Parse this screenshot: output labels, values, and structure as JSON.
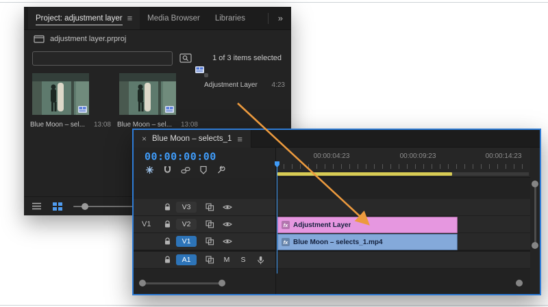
{
  "project": {
    "tabs": [
      {
        "label": "Project: adjustment layer"
      },
      {
        "label": "Media Browser"
      },
      {
        "label": "Libraries"
      }
    ],
    "panel_menu_glyph": "≡",
    "overflow_chevron": "»",
    "breadcrumb": "adjustment layer.prproj",
    "status": "1 of 3 items selected",
    "items": [
      {
        "name": "Blue Moon – sel...",
        "duration": "13:08"
      },
      {
        "name": "Blue Moon – sel...",
        "duration": "13:08"
      },
      {
        "name": "Adjustment Layer",
        "duration": "4:23"
      }
    ]
  },
  "timeline": {
    "close_glyph": "×",
    "tab_label": "Blue Moon – selects_1",
    "panel_menu_glyph": "≡",
    "timecode": "00:00:00:00",
    "ruler_labels": [
      "00:00:04:23",
      "00:00:09:23",
      "00:00:14:23"
    ],
    "tracks": {
      "v3": {
        "label": "V3"
      },
      "v2": {
        "label": "V2",
        "patch": "V1"
      },
      "v1": {
        "label": "V1"
      },
      "a1": {
        "label": "A1",
        "mute": "M",
        "solo": "S"
      }
    },
    "clips": {
      "adjustment": {
        "badge": "fx",
        "label": "Adjustment Layer"
      },
      "video": {
        "badge": "fx",
        "label": "Blue Moon – selects_1.mp4"
      }
    }
  },
  "colors": {
    "accent_blue": "#2d8ceb",
    "timecode_blue": "#3f9bf8",
    "clip_pink": "#e697e0",
    "clip_blue": "#84a9da",
    "workarea_yellow": "#d8cc55",
    "arrow_orange": "#ec9a3e"
  }
}
